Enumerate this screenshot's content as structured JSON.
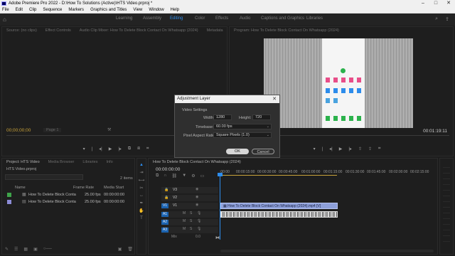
{
  "window": {
    "title": "Adobe Premiere Pro 2022 - D:\\How To Solutions (Active)\\HTS Video.prproj *",
    "controls": [
      "–",
      "□",
      "✕"
    ]
  },
  "menu": [
    "File",
    "Edit",
    "Clip",
    "Sequence",
    "Markers",
    "Graphics and Titles",
    "View",
    "Window",
    "Help"
  ],
  "workspaces": {
    "items": [
      "Learning",
      "Assembly",
      "Editing",
      "Color",
      "Effects",
      "Audio",
      "Captions and Graphics",
      "Libraries"
    ],
    "active": "Editing"
  },
  "source_panel": {
    "tabs": [
      "Source: (no clips)",
      "Effect Controls",
      "Audio Clip Mixer: How To Delete Block Contact On Whatsapp (2024)",
      "Metadata"
    ],
    "timecode": "00;00;00;00",
    "fit": "Page 1"
  },
  "program_panel": {
    "tab": "Program: How To Delete Block Contact On Whatsapp (2024)",
    "timecode": "00:01:19:11"
  },
  "project_panel": {
    "tabs": [
      "Project: HTS Video",
      "Media Browser",
      "Libraries",
      "Info"
    ],
    "path": "HTS Video.prproj",
    "count": "2 items",
    "columns": [
      "Name",
      "Frame Rate",
      "Media Start"
    ],
    "rows": [
      {
        "name": "How To Delete Block Conta",
        "rate": "25.00 fps",
        "start": "00:00:00:00",
        "color": "#3ea44a"
      },
      {
        "name": "How To Delete Block Conta",
        "rate": "25.00 fps",
        "start": "00:00:00:00",
        "color": "#8c8cd6"
      }
    ]
  },
  "timeline": {
    "tab": "How To Delete Block Contact On Whatsapp (2024)",
    "timecode": "00:00:00:00",
    "ruler": [
      ":00:00",
      "00:00:15:00",
      "00:00:30:00",
      "00:00:45:00",
      "00:01:00:00",
      "00:01:15:00",
      "00:01:30:00",
      "00:01:45:00",
      "00:02:00:00",
      "00:02:15:00"
    ],
    "video_tracks": [
      "V3",
      "V2",
      "V1"
    ],
    "audio_tracks": [
      "A1",
      "A2",
      "A3"
    ],
    "video_clip": "How To Delete Block Contact On Whatsapp (2024).mp4 [V]",
    "mix_label": "Mix",
    "mix_value": "0.0"
  },
  "dialog": {
    "title": "Adjustment Layer",
    "section": "Video Settings",
    "width_label": "Width:",
    "width_value": "1280",
    "height_label": "Height:",
    "height_value": "720",
    "timebase_label": "Timebase:",
    "timebase_value": "60.00 fps",
    "par_label": "Pixel Aspect Ratio:",
    "par_value": "Square Pixels (1.0)",
    "ok": "OK",
    "cancel": "Cancel"
  },
  "colors": {
    "accent": "#2d8ceb",
    "timecode": "#c8a23a",
    "video_clip": "#8d9fd9",
    "track_selected": "#1b63b0"
  }
}
